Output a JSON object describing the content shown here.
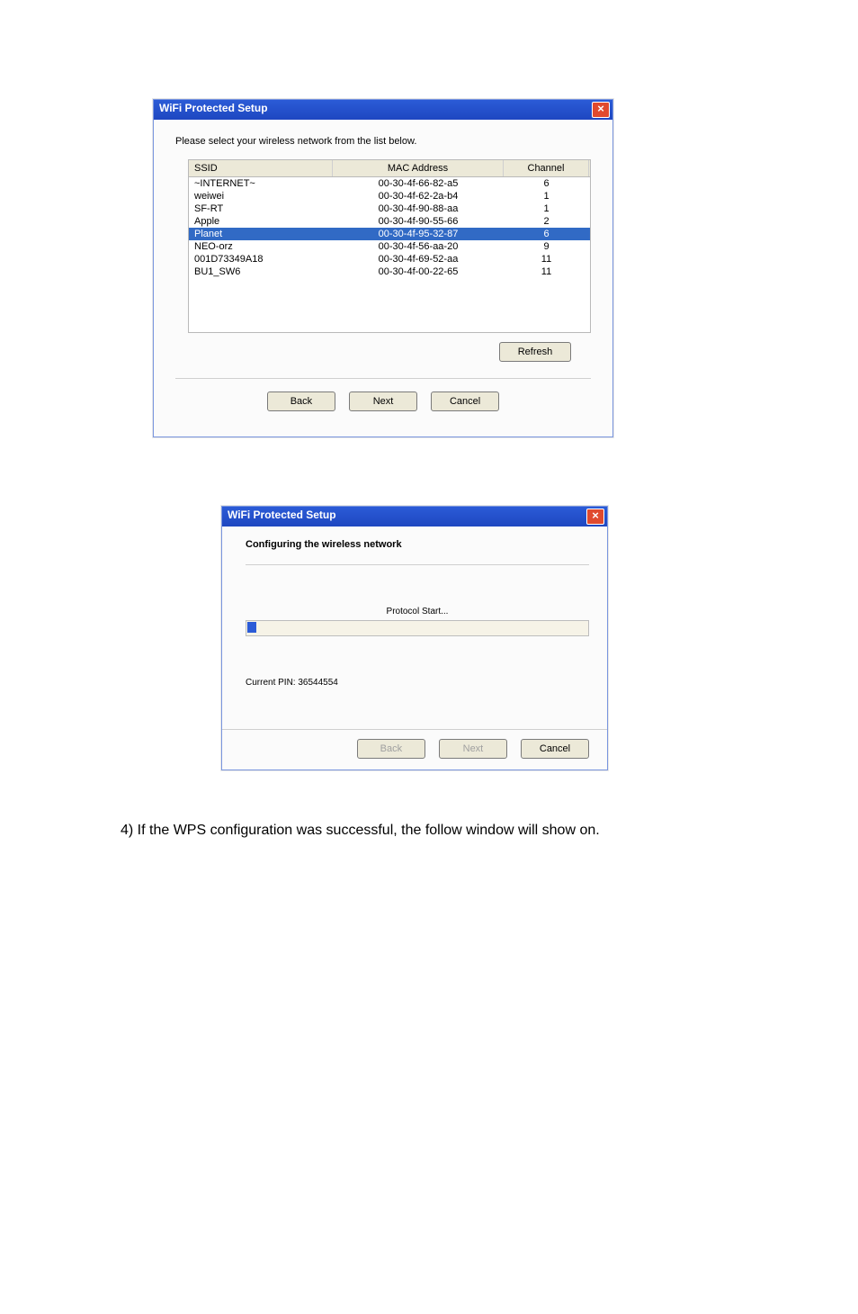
{
  "dialog1": {
    "title": "WiFi Protected Setup",
    "close_glyph": "×",
    "prompt": "Please select your wireless network from the list below.",
    "columns": {
      "ssid": "SSID",
      "mac": "MAC Address",
      "channel": "Channel"
    },
    "rows": [
      {
        "ssid": "~INTERNET~",
        "mac": "00-30-4f-66-82-a5",
        "channel": "6",
        "selected": false
      },
      {
        "ssid": "weiwei",
        "mac": "00-30-4f-62-2a-b4",
        "channel": "1",
        "selected": false
      },
      {
        "ssid": "SF-RT",
        "mac": "00-30-4f-90-88-aa",
        "channel": "1",
        "selected": false
      },
      {
        "ssid": "Apple",
        "mac": "00-30-4f-90-55-66",
        "channel": "2",
        "selected": false
      },
      {
        "ssid": "Planet",
        "mac": "00-30-4f-95-32-87",
        "channel": "6",
        "selected": true
      },
      {
        "ssid": "NEO-orz",
        "mac": "00-30-4f-56-aa-20",
        "channel": "9",
        "selected": false
      },
      {
        "ssid": "001D73349A18",
        "mac": "00-30-4f-69-52-aa",
        "channel": "11",
        "selected": false
      },
      {
        "ssid": "BU1_SW6",
        "mac": "00-30-4f-00-22-65",
        "channel": "11",
        "selected": false
      }
    ],
    "refresh_label": "Refresh",
    "back_label": "Back",
    "next_label": "Next",
    "cancel_label": "Cancel"
  },
  "dialog2": {
    "title": "WiFi Protected Setup",
    "close_glyph": "×",
    "heading": "Configuring the wireless network",
    "status": "Protocol Start...",
    "pin_text": "Current PIN: 36544554",
    "back_label": "Back",
    "next_label": "Next",
    "cancel_label": "Cancel"
  },
  "caption": "4)  If the WPS configuration was successful, the follow window will show on."
}
